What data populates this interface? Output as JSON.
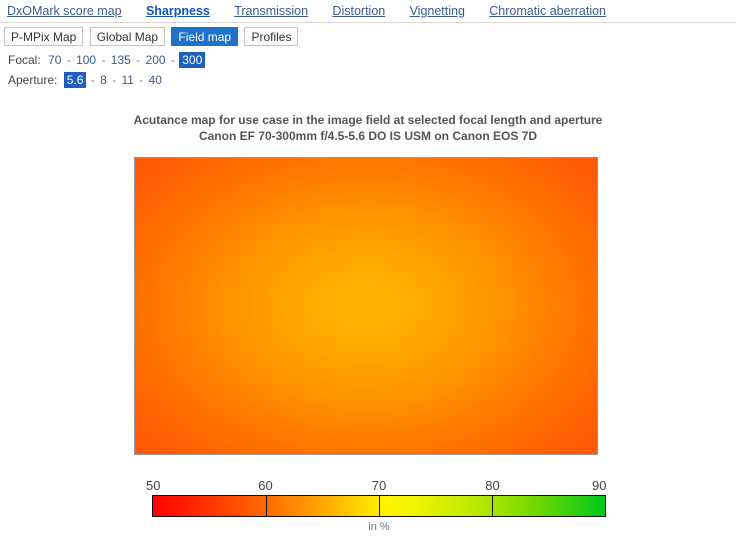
{
  "main_nav": {
    "items": [
      {
        "label": "DxOMark score map",
        "active": false
      },
      {
        "label": "Sharpness",
        "active": true
      },
      {
        "label": "Transmission",
        "active": false
      },
      {
        "label": "Distortion",
        "active": false
      },
      {
        "label": "Vignetting",
        "active": false
      },
      {
        "label": "Chromatic aberration",
        "active": false
      }
    ]
  },
  "sub_tabs": {
    "items": [
      {
        "label": "P-MPix Map",
        "active": false
      },
      {
        "label": "Global Map",
        "active": false
      },
      {
        "label": "Field map",
        "active": true
      },
      {
        "label": "Profiles",
        "active": false
      }
    ]
  },
  "focal": {
    "label": "Focal:",
    "options": [
      "70",
      "100",
      "135",
      "200",
      "300"
    ],
    "selected": "300",
    "separator": "-"
  },
  "aperture": {
    "label": "Aperture:",
    "options": [
      "5.6",
      "8",
      "11",
      "40"
    ],
    "selected": "5.6",
    "separator": "-"
  },
  "chart": {
    "title_line1": "Acutance map for use case in the image field at selected focal length and aperture",
    "title_line2": "Canon EF 70-300mm f/4.5-5.6 DO IS USM on Canon EOS 7D",
    "legend_unit": "in %"
  },
  "colors": {
    "accent_blue": "#1e73c8",
    "selected_blue": "#1e5fbe",
    "link_blue": "#3b5b92",
    "scale_low": "#ff0000",
    "scale_mid": "#fff500",
    "scale_high": "#00c81e",
    "map_center": "#ffb400",
    "map_corner": "#ff5508"
  },
  "chart_data": {
    "type": "heatmap",
    "title": "Acutance map for use case in the image field at selected focal length and aperture",
    "subtitle": "Canon EF 70-300mm f/4.5-5.6 DO IS USM on Canon EOS 7D",
    "xlabel": "",
    "ylabel": "",
    "unit": "in %",
    "colorbar": {
      "min": 50,
      "max": 90,
      "ticks": [
        50,
        60,
        70,
        80,
        90
      ],
      "tick_labels": [
        "50",
        "60",
        "70",
        "80",
        "90"
      ],
      "colors": [
        "#ff0000",
        "#ff8800",
        "#fff500",
        "#9ce200",
        "#00c81e"
      ],
      "position": "bottom"
    },
    "zlim": [
      50,
      90
    ],
    "grid": false,
    "description": "Radially symmetric acutance field: highest acutance at the image centre, falling off toward the corners.",
    "values_grid": [
      [
        57,
        58,
        59,
        59,
        59,
        58,
        57
      ],
      [
        58,
        60,
        62,
        62,
        62,
        60,
        58
      ],
      [
        59,
        62,
        64,
        65,
        64,
        62,
        59
      ],
      [
        59,
        62,
        65,
        65,
        65,
        62,
        59
      ],
      [
        59,
        62,
        64,
        65,
        64,
        62,
        59
      ],
      [
        58,
        60,
        62,
        62,
        62,
        60,
        58
      ],
      [
        57,
        58,
        59,
        59,
        59,
        58,
        57
      ]
    ],
    "center_value": 65,
    "corner_value": 57
  }
}
